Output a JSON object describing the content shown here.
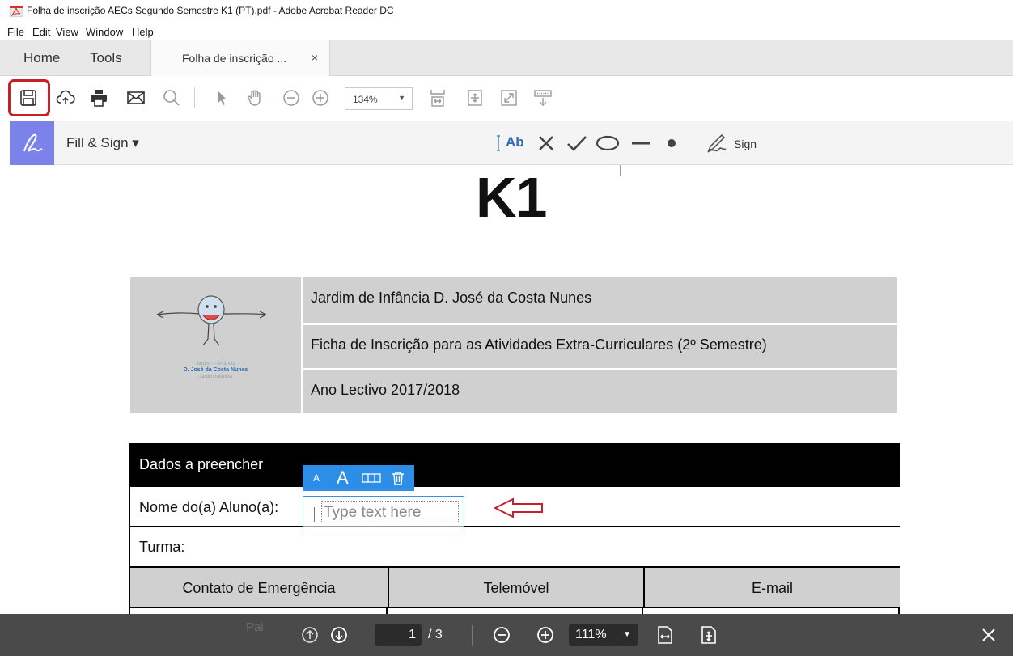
{
  "window": {
    "title": "Folha de inscrição AECs Segundo Semestre K1 (PT).pdf - Adobe Acrobat Reader DC"
  },
  "menu": [
    "File",
    "Edit",
    "View",
    "Window",
    "Help"
  ],
  "tabs": {
    "home": "Home",
    "tools": "Tools",
    "document": "Folha de inscrição ...",
    "close": "×"
  },
  "toolbar": {
    "zoom": "134%",
    "icons": [
      "save-icon",
      "cloud-upload-icon",
      "print-icon",
      "email-icon",
      "search-icon",
      "select-arrow-icon",
      "hand-icon",
      "zoom-out-icon",
      "zoom-in-icon",
      "fit-page-icon",
      "rotate-icon",
      "full-screen-icon",
      "read-mode-icon"
    ]
  },
  "fill_sign": {
    "label": "Fill & Sign ▾",
    "text_tool": "Ab",
    "sign": "Sign"
  },
  "document": {
    "heading": "K1",
    "school": "Jardim de Infância D. José da Costa Nunes",
    "form_title": "Ficha de Inscrição para as Atividades Extra-Curriculares (2º Semestre)",
    "year": "Ano Lectivo 2017/2018",
    "logo": {
      "line1": "Jardim — Infância",
      "line2": "D. José da Costa Nunes",
      "line3": "Jardim Infância"
    },
    "section_header": "Dados a preencher",
    "student_name_label": "Nome do(a) Aluno(a):",
    "class_label": "Turma:",
    "columns": [
      "Contato de Emergência",
      "Telemóvel",
      "E-mail"
    ],
    "partial_row_label": "Pai"
  },
  "text_field": {
    "placeholder": "Type text here",
    "small_a": "A",
    "big_a": "A"
  },
  "bottom_nav": {
    "current_page": "1",
    "total_pages": "/ 3",
    "zoom": "111%"
  },
  "colors": {
    "highlight_red": "#c8202a",
    "fill_sign_purple": "#7b83eb",
    "text_field_blue": "#2d8ee8",
    "nav_bg": "#4a4a4a"
  }
}
